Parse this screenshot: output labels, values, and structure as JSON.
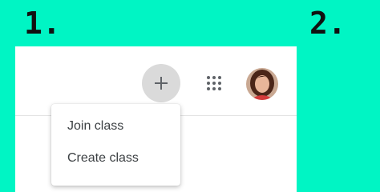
{
  "steps": {
    "first": "1.",
    "second": "2."
  },
  "toolbar": {
    "add_icon": "plus-icon",
    "apps_icon": "apps-grid-icon",
    "avatar_icon": "user-avatar"
  },
  "menu": {
    "items": [
      {
        "label": "Join class"
      },
      {
        "label": "Create class"
      }
    ]
  },
  "colors": {
    "background": "#00f5c4",
    "panel": "#ffffff",
    "plus_button": "#dadada",
    "text": "#3c4043"
  }
}
